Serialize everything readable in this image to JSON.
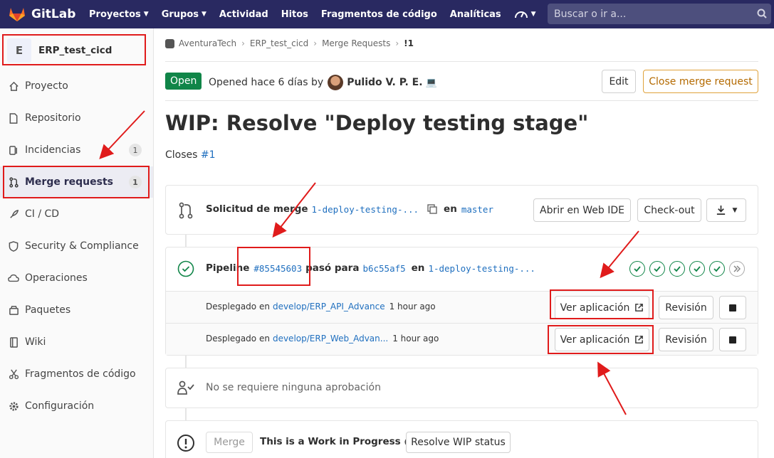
{
  "topnav": {
    "brand": "GitLab",
    "items": [
      {
        "label": "Proyectos",
        "caret": true
      },
      {
        "label": "Grupos",
        "caret": true
      },
      {
        "label": "Actividad",
        "caret": false
      },
      {
        "label": "Hitos",
        "caret": false
      },
      {
        "label": "Fragmentos de código",
        "caret": false
      },
      {
        "label": "Analíticas",
        "caret": false
      }
    ],
    "search_placeholder": "Buscar o ir a...",
    "bg_color": "#292961"
  },
  "sidebar": {
    "project_initial": "E",
    "project_name": "ERP_test_cicd",
    "items": [
      {
        "label": "Proyecto",
        "icon": "home-icon"
      },
      {
        "label": "Repositorio",
        "icon": "file-icon"
      },
      {
        "label": "Incidencias",
        "icon": "issues-icon",
        "count": "1"
      },
      {
        "label": "Merge requests",
        "icon": "merge-request-icon",
        "count": "1",
        "active": true
      },
      {
        "label": "CI / CD",
        "icon": "rocket-icon"
      },
      {
        "label": "Security & Compliance",
        "icon": "shield-icon"
      },
      {
        "label": "Operaciones",
        "icon": "cloud-icon"
      },
      {
        "label": "Paquetes",
        "icon": "package-icon"
      },
      {
        "label": "Wiki",
        "icon": "book-icon"
      },
      {
        "label": "Fragmentos de código",
        "icon": "snippet-icon"
      },
      {
        "label": "Configuración",
        "icon": "gear-icon"
      }
    ]
  },
  "breadcrumb": [
    "AventuraTech",
    "ERP_test_cicd",
    "Merge Requests",
    "!1"
  ],
  "mr": {
    "status": "Open",
    "opened": "Opened hace 6 días by",
    "author": "Pulido V. P. E.",
    "author_emoji": "💻",
    "edit_label": "Edit",
    "close_label": "Close merge request",
    "title": "WIP: Resolve \"Deploy testing stage\"",
    "closes_prefix": "Closes",
    "closes_ref": "#1"
  },
  "merge_widget": {
    "label": "Solicitud de merge",
    "source_branch": "1-deploy-testing-...",
    "into": "en",
    "target_branch": "master",
    "web_ide_label": "Abrir en Web IDE",
    "checkout_label": "Check-out"
  },
  "pipeline": {
    "prefix": "Pipeline",
    "id": "#85545603",
    "passed": "pasó para",
    "commit": "b6c55af5",
    "in": "en",
    "branch": "1-deploy-testing-...",
    "stages_passed": 5,
    "success_color": "#108548"
  },
  "deployments": [
    {
      "prefix": "Desplegado en",
      "env": "develop/ERP_API_Advance",
      "time": "1 hour ago",
      "view_label": "Ver aplicación",
      "review_label": "Revisión"
    },
    {
      "prefix": "Desplegado en",
      "env": "develop/ERP_Web_Advan...",
      "time": "1 hour ago",
      "view_label": "Ver aplicación",
      "review_label": "Revisión"
    }
  ],
  "approval": {
    "text": "No se requiere ninguna aprobación"
  },
  "wip": {
    "merge_label": "Merge",
    "message": "This is a Work in Progress",
    "resolve_label": "Resolve WIP status"
  },
  "annotation_color": "#e01b1b"
}
